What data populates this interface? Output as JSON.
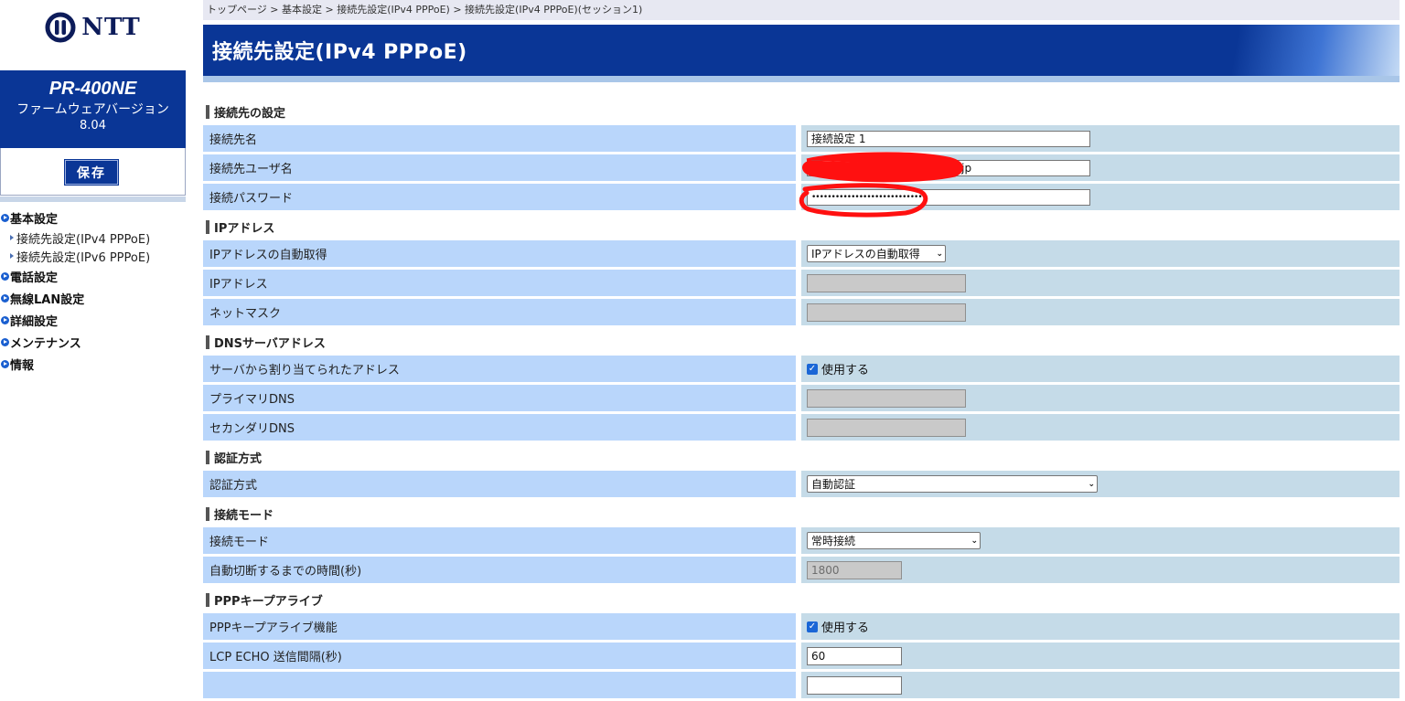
{
  "sidebar": {
    "logo_text": "NTT",
    "product_name": "PR-400NE",
    "firmware_label": "ファームウェアバージョン",
    "firmware_version": "8.04",
    "save_label": "保存",
    "nav": [
      {
        "label": "基本設定",
        "children": [
          "接続先設定(IPv4 PPPoE)",
          "接続先設定(IPv6 PPPoE)"
        ]
      },
      {
        "label": "電話設定"
      },
      {
        "label": "無線LAN設定"
      },
      {
        "label": "詳細設定"
      },
      {
        "label": "メンテナンス"
      },
      {
        "label": "情報"
      }
    ]
  },
  "breadcrumb": "トップページ > 基本設定 > 接続先設定(IPv4 PPPoE) > 接続先設定(IPv4 PPPoE)(セッション1)",
  "page_title": "接続先設定(IPv4 PPPoE)",
  "sections": {
    "connection": {
      "title": "接続先の設定",
      "name_label": "接続先名",
      "name_value": "接続設定 1",
      "user_label": "接続先ユーザ名",
      "user_value": "@sbb.ne.jp",
      "password_label": "接続パスワード",
      "password_value": "••••••••••••••••••••••••••••"
    },
    "ip": {
      "title": "IPアドレス",
      "auto_label": "IPアドレスの自動取得",
      "auto_value": "IPアドレスの自動取得",
      "address_label": "IPアドレス",
      "netmask_label": "ネットマスク"
    },
    "dns": {
      "title": "DNSサーバアドレス",
      "assigned_label": "サーバから割り当てられたアドレス",
      "assigned_check": "使用する",
      "primary_label": "プライマリDNS",
      "secondary_label": "セカンダリDNS"
    },
    "auth": {
      "title": "認証方式",
      "method_label": "認証方式",
      "method_value": "自動認証"
    },
    "mode": {
      "title": "接続モード",
      "mode_label": "接続モード",
      "mode_value": "常時接続",
      "timeout_label": "自動切断するまでの時間(秒)",
      "timeout_value": "1800"
    },
    "keepalive": {
      "title": "PPPキープアライブ",
      "func_label": "PPPキープアライブ機能",
      "func_check": "使用する",
      "interval_label": "LCP ECHO 送信間隔(秒)",
      "interval_value": "60"
    }
  },
  "colors": {
    "brand_blue": "#0a3696",
    "label_bg": "#b9d6fb",
    "value_bg": "#c5dbe8",
    "redaction": "#ff0000"
  }
}
